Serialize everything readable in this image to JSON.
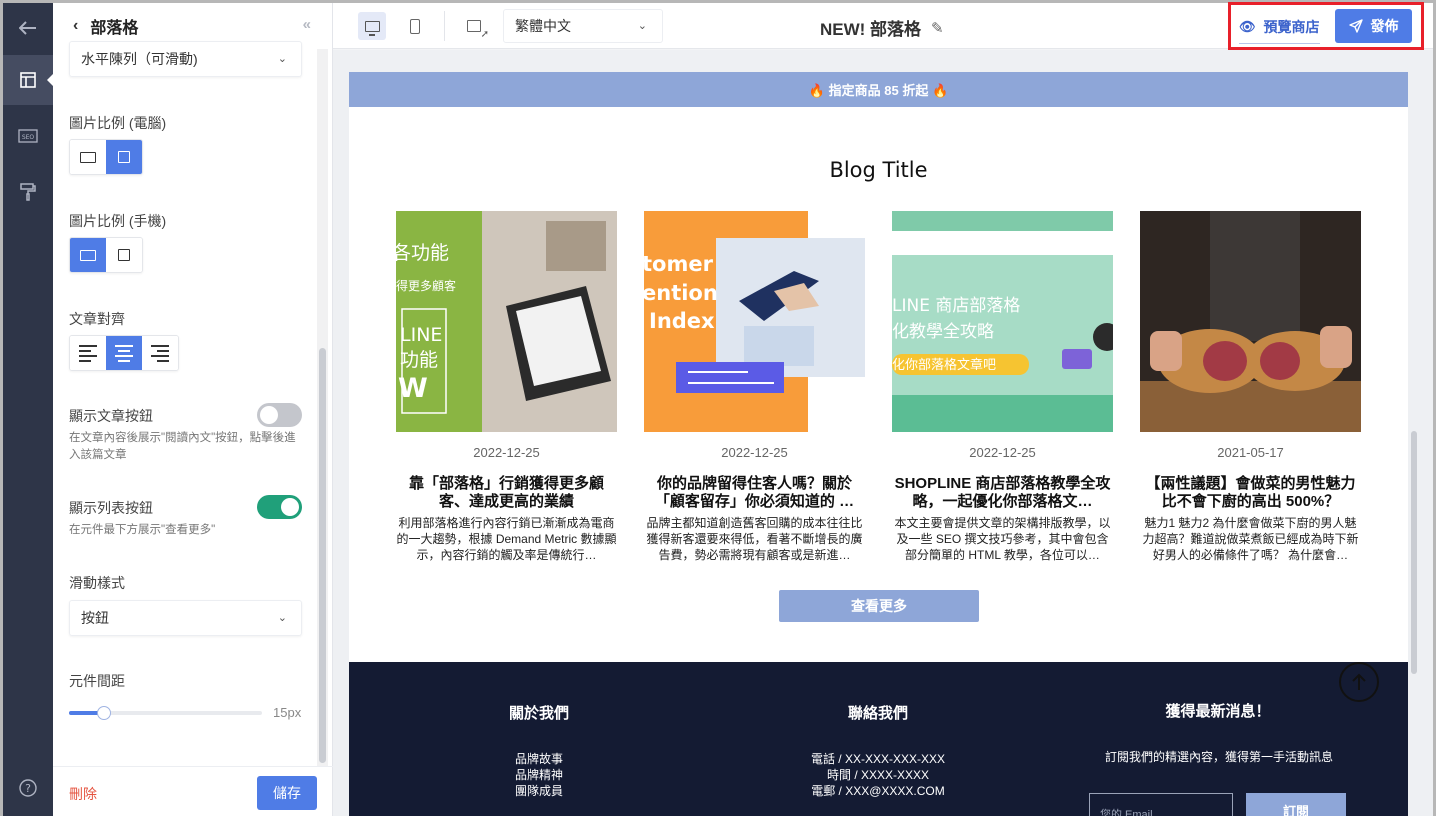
{
  "rail": {
    "items": [
      {
        "name": "back-arrow-icon",
        "glyph": "←"
      },
      {
        "name": "layout-icon",
        "glyph": "▤"
      },
      {
        "name": "seo-icon",
        "glyph": "SEO"
      },
      {
        "name": "paint-roller-icon",
        "glyph": "⚒"
      },
      {
        "name": "help-icon",
        "glyph": "?"
      }
    ]
  },
  "panel": {
    "header_title": "部落格",
    "back_glyph": "‹",
    "collapse_glyph": "«",
    "layout_select": "水平陳列（可滑動)",
    "ratio_desktop_label": "圖片比例 (電腦)",
    "ratio_mobile_label": "圖片比例 (手機)",
    "align_label": "文章對齊",
    "show_article_btn_label": "顯示文章按鈕",
    "show_article_btn_desc": "在文章內容後展示\"閱讀內文\"按鈕，點擊後進入該篇文章",
    "show_article_btn_on": false,
    "show_list_btn_label": "顯示列表按鈕",
    "show_list_btn_desc": "在元件最下方展示\"查看更多\"",
    "show_list_btn_on": true,
    "scroll_style_label": "滑動樣式",
    "scroll_style_value": "按鈕",
    "spacing_label": "元件間距",
    "spacing_value": "15px",
    "spacing_fraction": 0.18,
    "delete_label": "刪除",
    "save_label": "儲存"
  },
  "topbar": {
    "language": "繁體中文",
    "page_title": "NEW! 部落格",
    "preview_label": "預覽商店",
    "publish_label": "發佈"
  },
  "page": {
    "promo": "🔥 指定商品 85 折起 🔥",
    "blog_title": "Blog Title",
    "posts": [
      {
        "date": "2022-12-25",
        "title": "靠「部落格」行銷獲得更多顧客、達成更高的業績",
        "excerpt": "利用部落格進行內容行銷已漸漸成為電商的一大趨勢，根據 Demand Metric 數據顯示，內容行銷的觸及率是傳統行…",
        "thumb_text": [
          "各功能",
          "得更多顧客",
          "LINE",
          "功能",
          "W"
        ]
      },
      {
        "date": "2022-12-25",
        "title": "你的品牌留得住客人嗎？關於「顧客留存」你必須知道的 …",
        "excerpt": "品牌主都知道創造舊客回購的成本往往比獲得新客還要來得低，看著不斷增長的廣告費，勢必需將現有顧客或是新進…",
        "thumb_text": [
          "tomer",
          "ention",
          "Index"
        ]
      },
      {
        "date": "2022-12-25",
        "title": "SHOPLINE 商店部落格教學全攻略，一起優化你部落格文…",
        "excerpt": "本文主要會提供文章的架構排版教學，以及一些 SEO 撰文技巧參考，其中會包含部分簡單的 HTML 教學，各位可以…",
        "thumb_text": [
          "LINE 商店部落格",
          "化教學全攻略",
          "化你部落格文章吧"
        ]
      },
      {
        "date": "2021-05-17",
        "title": "【兩性議題】會做菜的男性魅力比不會下廚的高出 500%？",
        "excerpt": "魅力1 魅力2 為什麼會做菜下廚的男人魅力超高？難道說做菜煮飯已經成為時下新好男人的必備條件了嗎？ 為什麼會…",
        "thumb_text": []
      }
    ],
    "more_label": "查看更多",
    "footer": {
      "about_title": "關於我們",
      "about_links": [
        "品牌故事",
        "品牌精神",
        "團隊成員"
      ],
      "contact_title": "聯絡我們",
      "contact_lines": [
        "電話 / XX-XXX-XXX-XXX",
        "時間 / XXXX-XXXX",
        "電郵 / XXX@XXXX.COM"
      ],
      "news_title": "獲得最新消息！",
      "news_desc": "訂閱我們的精選內容，獲得第一手活動訊息",
      "email_placeholder": "您的 Email",
      "subscribe_label": "訂閱"
    }
  },
  "colors": {
    "accent": "#4f7ce6",
    "promo": "#8ea6d8",
    "footer": "#141b33",
    "toggle_on": "#20a07a",
    "highlight": "#e8202a"
  }
}
